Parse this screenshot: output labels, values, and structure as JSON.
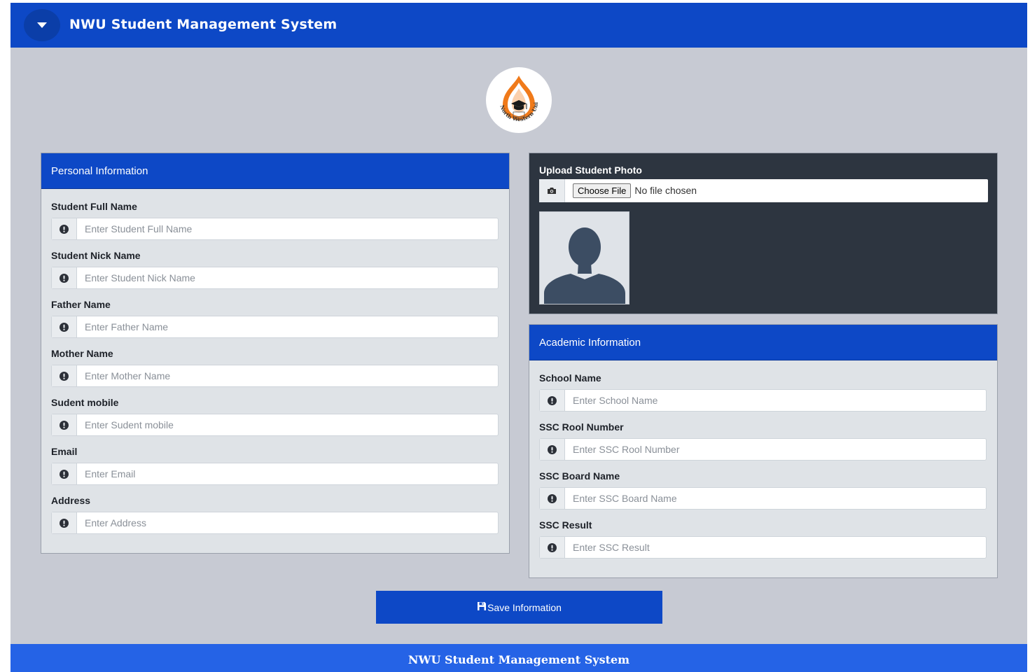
{
  "header": {
    "title": "NWU Student Management System",
    "toggle_icon": "caret-down-icon"
  },
  "logo": {
    "text": "North Western University",
    "icon": "graduation-cap-icon"
  },
  "personal": {
    "title": "Personal Information",
    "fields": [
      {
        "label": "Student Full Name",
        "placeholder": "Enter Student Full Name"
      },
      {
        "label": "Student Nick Name",
        "placeholder": "Enter Student Nick Name"
      },
      {
        "label": "Father Name",
        "placeholder": "Enter Father Name"
      },
      {
        "label": "Mother Name",
        "placeholder": "Enter Mother Name"
      },
      {
        "label": "Sudent mobile",
        "placeholder": "Enter Sudent mobile"
      },
      {
        "label": "Email",
        "placeholder": "Enter Email"
      },
      {
        "label": "Address",
        "placeholder": "Enter Address"
      }
    ]
  },
  "photo": {
    "label": "Upload Student Photo",
    "choose_label": "Choose File",
    "status": "No file chosen",
    "addon_icon": "camera-icon"
  },
  "academic": {
    "title": "Academic Information",
    "fields": [
      {
        "label": "School Name",
        "placeholder": "Enter School Name"
      },
      {
        "label": "SSC Rool Number",
        "placeholder": "Enter SSC Rool Number"
      },
      {
        "label": "SSC Board Name",
        "placeholder": "Enter SSC Board Name"
      },
      {
        "label": "SSC Result",
        "placeholder": "Enter SSC Result"
      }
    ]
  },
  "save": {
    "label": "Save Information",
    "icon": "save-icon"
  },
  "footer": {
    "text": "NWU Student Management System"
  },
  "colors": {
    "primary": "#0d48c6",
    "footer": "#2563e6",
    "photo_panel": "#2d3540",
    "page_bg": "#c7cad3"
  }
}
